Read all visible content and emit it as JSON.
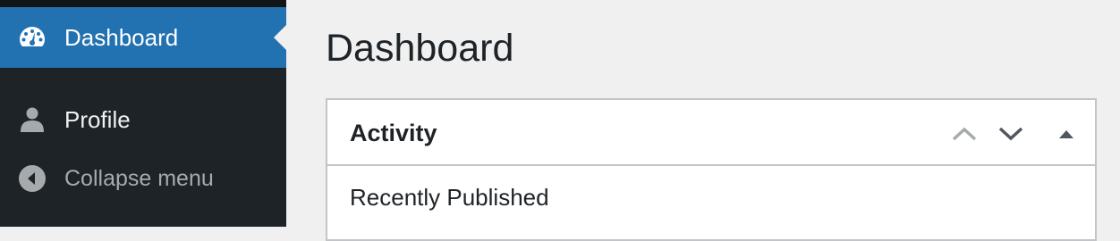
{
  "sidebar": {
    "items": [
      {
        "label": "Dashboard",
        "icon": "dashboard-icon",
        "active": true
      },
      {
        "label": "Profile",
        "icon": "user-icon"
      },
      {
        "label": "Collapse menu",
        "icon": "collapse-icon"
      }
    ]
  },
  "main": {
    "title": "Dashboard",
    "widget": {
      "title": "Activity",
      "section": "Recently Published",
      "controls": [
        "move-up-icon",
        "move-down-icon",
        "toggle-panel-icon"
      ]
    }
  },
  "colors": {
    "sidebar_bg": "#1d2327",
    "active_bg": "#2271b1",
    "page_bg": "#f0f0f1",
    "border": "#c3c4c7"
  }
}
